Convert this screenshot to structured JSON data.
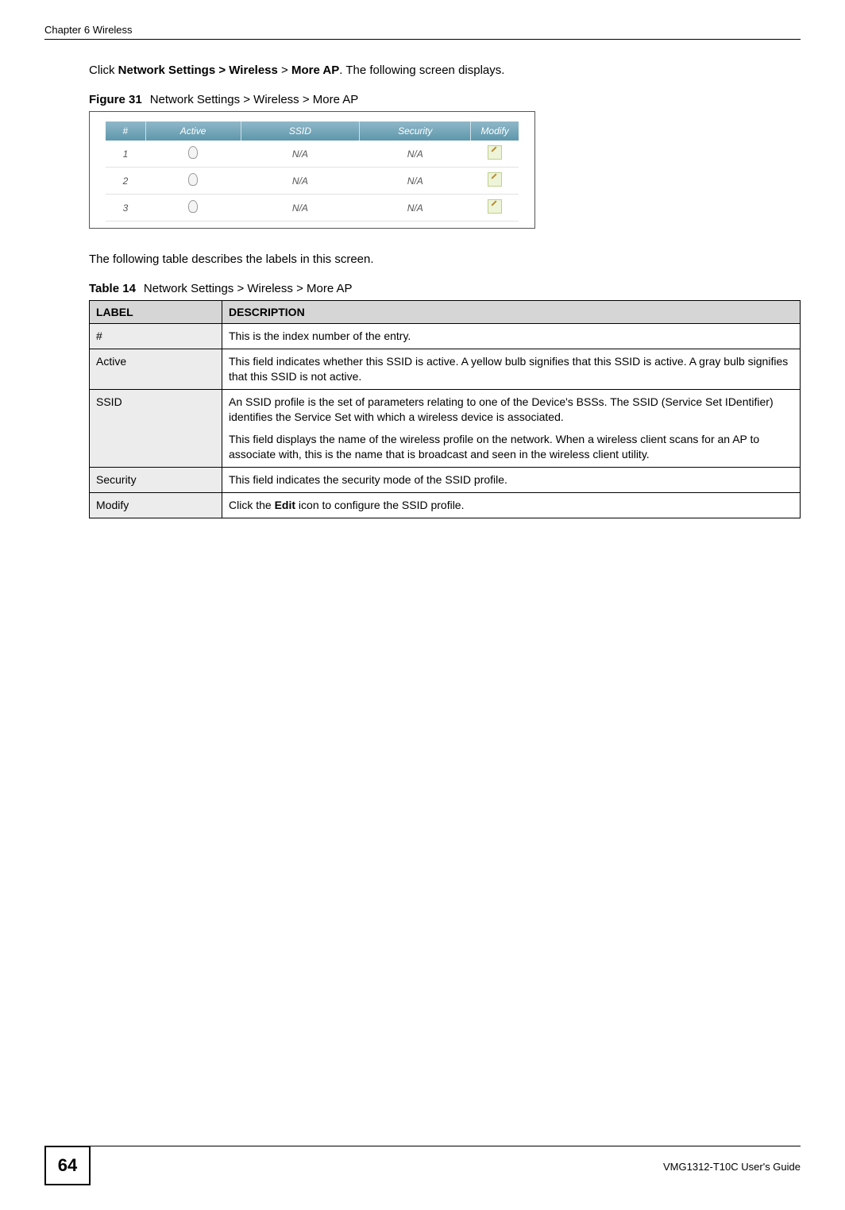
{
  "header": {
    "chapter": "Chapter 6 Wireless"
  },
  "intro": {
    "pre": "Click ",
    "b1": "Network Settings > Wireless",
    "mid": " > ",
    "b2": "More AP",
    "post": ". The following screen displays."
  },
  "figure": {
    "label": "Figure 31",
    "caption": "Network Settings > Wireless > More AP",
    "columns": [
      "#",
      "Active",
      "SSID",
      "Security",
      "Modify"
    ],
    "rows": [
      {
        "num": "1",
        "ssid": "N/A",
        "security": "N/A"
      },
      {
        "num": "2",
        "ssid": "N/A",
        "security": "N/A"
      },
      {
        "num": "3",
        "ssid": "N/A",
        "security": "N/A"
      }
    ]
  },
  "labelsIntro": "The following table describes the labels in this screen.",
  "table": {
    "label": "Table 14",
    "caption": "Network Settings > Wireless > More AP",
    "headers": [
      "LABEL",
      "DESCRIPTION"
    ],
    "rows": [
      {
        "label": "#",
        "desc": "This is the index number of the entry."
      },
      {
        "label": "Active",
        "desc": "This field indicates whether this SSID is active. A yellow bulb signifies that this SSID is active. A gray bulb signifies that this SSID is not active."
      },
      {
        "label": "SSID",
        "desc_p1": "An SSID profile is the set of parameters relating to one of the Device's BSSs. The SSID (Service Set IDentifier) identifies the Service Set with which a wireless device is associated.",
        "desc_p2": "This field displays the name of the wireless profile on the network. When a wireless client scans for an AP to associate with, this is the name that is broadcast and seen in the wireless client utility."
      },
      {
        "label": "Security",
        "desc": "This field indicates the security mode of the SSID profile."
      },
      {
        "label": "Modify",
        "desc_pre": "Click the ",
        "desc_bold": "Edit",
        "desc_post": " icon to configure the SSID profile."
      }
    ]
  },
  "footer": {
    "pageNumber": "64",
    "guide": "VMG1312-T10C User's Guide"
  }
}
